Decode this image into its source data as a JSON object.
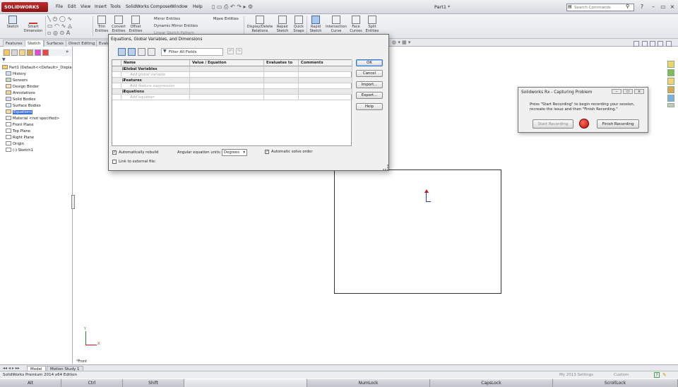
{
  "app": {
    "logo_text": "SOLIDWORKS",
    "document_title": "Part1 *",
    "menu": [
      "File",
      "Edit",
      "View",
      "Insert",
      "Tools",
      "SolidWorks Composer",
      "Window",
      "Help"
    ],
    "search_placeholder": "Search Commands"
  },
  "ribbon": {
    "sketch": "Sketch",
    "smart_dimension": "Smart Dimension",
    "trim_entities": "Trim Entities",
    "convert_entities": "Convert Entities",
    "offset_entities": "Offset Entities",
    "mirror_entities": "Mirror Entities",
    "dynamic_mirror": "Dynamic Mirror Entities",
    "linear_sketch": "Linear Sketch Pattern",
    "move_entities": "Move Entities",
    "display_relations": "Display/Delete Relations",
    "repair_sketch": "Repair Sketch",
    "quick_snaps": "Quick Snaps",
    "rapid_sketch": "Rapid Sketch",
    "intersection_curve": "Intersection Curve",
    "face_curves": "Face Curves",
    "split_entities": "Split Entities"
  },
  "tabs": [
    "Features",
    "Sketch",
    "Surfaces",
    "Direct Editing",
    "Evalu"
  ],
  "tree": {
    "part": "Part1  (Default<<Default>_Displa",
    "items": [
      {
        "label": "History",
        "selected": false
      },
      {
        "label": "Sensors",
        "selected": false
      },
      {
        "label": "Design Binder",
        "selected": false
      },
      {
        "label": "Annotations",
        "selected": false
      },
      {
        "label": "Solid Bodies",
        "selected": false
      },
      {
        "label": "Surface Bodies",
        "selected": false
      },
      {
        "label": "Equations",
        "selected": true
      },
      {
        "label": "Material <not specified>",
        "selected": false
      },
      {
        "label": "Front Plane",
        "selected": false
      },
      {
        "label": "Top Plane",
        "selected": false
      },
      {
        "label": "Right Plane",
        "selected": false
      },
      {
        "label": "Origin",
        "selected": false
      },
      {
        "label": "(-) Sketch1",
        "selected": false
      }
    ]
  },
  "viewport": {
    "view_label": "*Front"
  },
  "equations_dialog": {
    "title": "Equations, Global Variables, and Dimensions",
    "filter_placeholder": "Filter All Fields",
    "columns": [
      "Name",
      "Value / Equation",
      "Evaluates to",
      "Comments"
    ],
    "rows": [
      {
        "type": "section",
        "name": "Global Variables"
      },
      {
        "type": "placeholder",
        "name": "Add global variable"
      },
      {
        "type": "section",
        "name": "Features"
      },
      {
        "type": "placeholder",
        "name": "Add feature suppression"
      },
      {
        "type": "section",
        "name": "Equations"
      },
      {
        "type": "placeholder",
        "name": "Add equation"
      }
    ],
    "buttons": {
      "ok": "OK",
      "cancel": "Cancel",
      "import": "Import...",
      "export": "Export...",
      "help": "Help"
    },
    "auto_rebuild": "Automatically rebuild",
    "link_external": "Link to external file:",
    "angular_units_label": "Angular equation units:",
    "angular_units_value": "Degrees",
    "auto_solve": "Automatic solve order"
  },
  "rx_dialog": {
    "title": "Solidworks Rx - Capturing Problem",
    "message": "Press \"Start Recording\" to begin recording your session,\nrecreate the issue and then \"Finish Recording.\"",
    "start": "Start Recording",
    "finish": "Finish Recording"
  },
  "bottom_tabs": [
    "Model",
    "Motion Study 1"
  ],
  "status": {
    "edition": "SolidWorks Premium 2014 x64 Edition",
    "settings": "My 2013 Settings",
    "units": "Custom"
  },
  "keys": [
    "Alt",
    "Ctrl",
    "Shift",
    "",
    "NumLock",
    "CapsLock",
    "ScrollLock"
  ]
}
